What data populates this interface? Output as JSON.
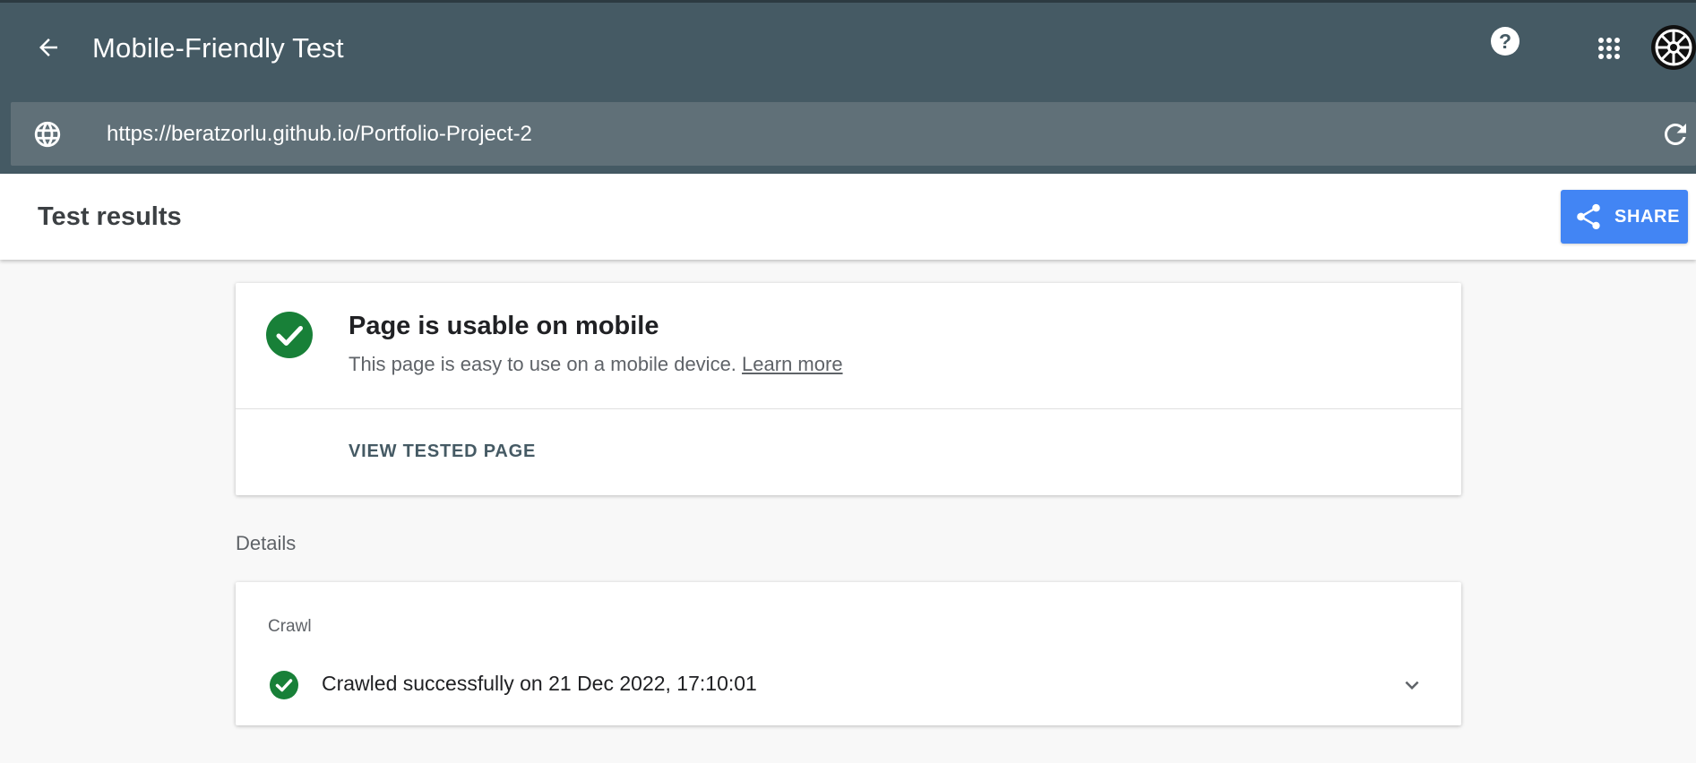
{
  "header": {
    "title": "Mobile-Friendly Test",
    "help_symbol": "?",
    "icons": {
      "back": "arrow-back-icon",
      "help": "help-icon",
      "apps": "apps-grid-icon",
      "avatar": "avatar-emblem"
    }
  },
  "urlbar": {
    "value": "https://beratzorlu.github.io/Portfolio-Project-2",
    "icons": {
      "globe": "globe-icon",
      "reload": "reload-icon"
    }
  },
  "results": {
    "title": "Test results",
    "share_label": "SHARE"
  },
  "summary": {
    "headline": "Page is usable on mobile",
    "description": "This page is easy to use on a mobile device.",
    "learn_more": "Learn more",
    "view_tested_page": "VIEW TESTED PAGE",
    "status_color": "#188038"
  },
  "details": {
    "label": "Details",
    "crawl": {
      "label": "Crawl",
      "status_text": "Crawled successfully on 21 Dec 2022, 17:10:01"
    }
  },
  "colors": {
    "header_bg": "#455a64",
    "urlbar_bg": "#607078",
    "share_btn": "#4285f4",
    "success_green": "#188038"
  }
}
